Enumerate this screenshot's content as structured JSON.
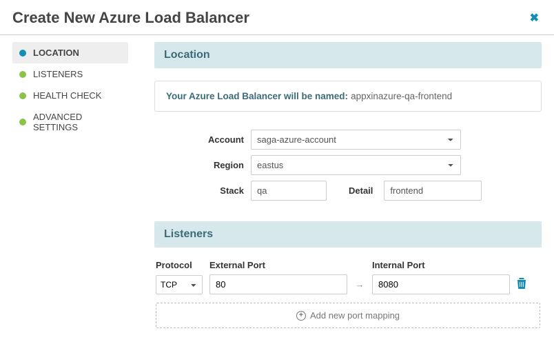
{
  "title": "Create New Azure Load Balancer",
  "sidebar": {
    "items": [
      {
        "label": "LOCATION",
        "active": true,
        "color": "blue"
      },
      {
        "label": "LISTENERS",
        "active": false,
        "color": "green"
      },
      {
        "label": "HEALTH CHECK",
        "active": false,
        "color": "green"
      },
      {
        "label": "ADVANCED SETTINGS",
        "active": false,
        "color": "green"
      }
    ]
  },
  "location": {
    "header": "Location",
    "info_label": "Your Azure Load Balancer will be named:",
    "info_value": "appxinazure-qa-frontend",
    "account_label": "Account",
    "account_value": "saga-azure-account",
    "region_label": "Region",
    "region_value": "eastus",
    "stack_label": "Stack",
    "stack_value": "qa",
    "detail_label": "Detail",
    "detail_value": "frontend"
  },
  "listeners": {
    "header": "Listeners",
    "protocol_label": "Protocol",
    "ext_label": "External Port",
    "int_label": "Internal Port",
    "arrow": "→",
    "rows": [
      {
        "protocol": "TCP",
        "external": "80",
        "internal": "8080"
      }
    ],
    "add_label": "Add new port mapping"
  }
}
